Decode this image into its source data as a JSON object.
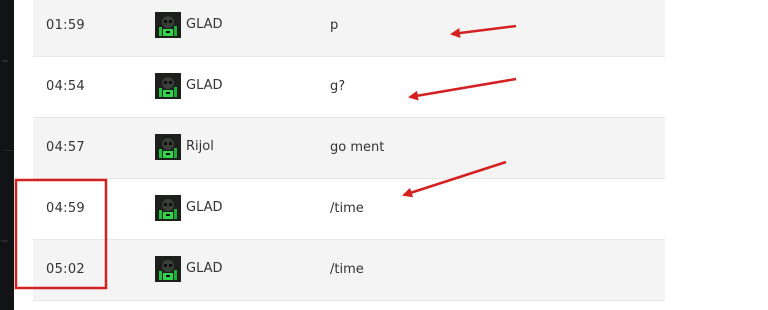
{
  "chat_log": {
    "rows": [
      {
        "time": "01:59",
        "player": "GLAD",
        "message": "p"
      },
      {
        "time": "04:54",
        "player": "GLAD",
        "message": "g?"
      },
      {
        "time": "04:57",
        "player": "Rijol",
        "message": "go ment"
      },
      {
        "time": "04:59",
        "player": "GLAD",
        "message": "/time"
      },
      {
        "time": "05:02",
        "player": "GLAD",
        "message": "/time"
      }
    ]
  },
  "annotations": {
    "color": "#d42020",
    "arrows": 3,
    "highlight_box": "time-column rows 04:59-05:02"
  }
}
